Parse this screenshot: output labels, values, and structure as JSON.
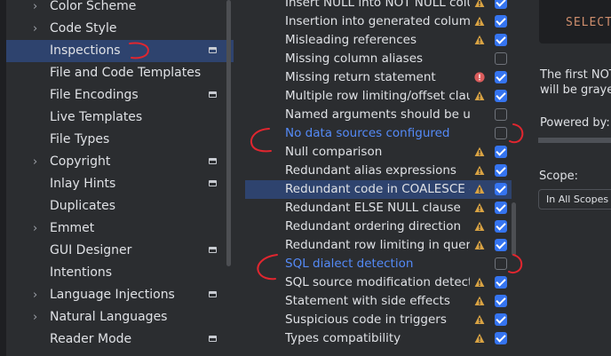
{
  "sidebar": {
    "items": [
      {
        "label": "Color Scheme",
        "chevron": true,
        "badge": false,
        "selected": false
      },
      {
        "label": "Code Style",
        "chevron": true,
        "badge": false,
        "selected": false
      },
      {
        "label": "Inspections",
        "chevron": false,
        "badge": true,
        "selected": true
      },
      {
        "label": "File and Code Templates",
        "chevron": false,
        "badge": false,
        "selected": false
      },
      {
        "label": "File Encodings",
        "chevron": false,
        "badge": true,
        "selected": false
      },
      {
        "label": "Live Templates",
        "chevron": false,
        "badge": false,
        "selected": false
      },
      {
        "label": "File Types",
        "chevron": false,
        "badge": false,
        "selected": false
      },
      {
        "label": "Copyright",
        "chevron": true,
        "badge": true,
        "selected": false
      },
      {
        "label": "Inlay Hints",
        "chevron": false,
        "badge": true,
        "selected": false
      },
      {
        "label": "Duplicates",
        "chevron": false,
        "badge": false,
        "selected": false
      },
      {
        "label": "Emmet",
        "chevron": true,
        "badge": false,
        "selected": false
      },
      {
        "label": "GUI Designer",
        "chevron": false,
        "badge": true,
        "selected": false
      },
      {
        "label": "Intentions",
        "chevron": false,
        "badge": false,
        "selected": false
      },
      {
        "label": "Language Injections",
        "chevron": true,
        "badge": true,
        "selected": false
      },
      {
        "label": "Natural Languages",
        "chevron": true,
        "badge": false,
        "selected": false
      },
      {
        "label": "Reader Mode",
        "chevron": false,
        "badge": true,
        "selected": false
      }
    ]
  },
  "inspections": {
    "rows": [
      {
        "label": "Insert NULL into NOT NULL column",
        "severity": "warning",
        "checked": true,
        "link": false,
        "selected": false
      },
      {
        "label": "Insertion into generated columns",
        "severity": "warning",
        "checked": true,
        "link": false,
        "selected": false
      },
      {
        "label": "Misleading references",
        "severity": "warning",
        "checked": true,
        "link": false,
        "selected": false
      },
      {
        "label": "Missing column aliases",
        "severity": "none",
        "checked": false,
        "link": false,
        "selected": false
      },
      {
        "label": "Missing return statement",
        "severity": "error",
        "checked": true,
        "link": false,
        "selected": false
      },
      {
        "label": "Multiple row limiting/offset clauses",
        "severity": "warning",
        "checked": true,
        "link": false,
        "selected": false
      },
      {
        "label": "Named arguments should be used",
        "severity": "none",
        "checked": false,
        "link": false,
        "selected": false
      },
      {
        "label": "No data sources configured",
        "severity": "none",
        "checked": false,
        "link": true,
        "selected": false
      },
      {
        "label": "Null comparison",
        "severity": "warning",
        "checked": true,
        "link": false,
        "selected": false
      },
      {
        "label": "Redundant alias expressions",
        "severity": "warning",
        "checked": true,
        "link": false,
        "selected": false
      },
      {
        "label": "Redundant code in COALESCE call",
        "severity": "warning",
        "checked": true,
        "link": false,
        "selected": true
      },
      {
        "label": "Redundant ELSE NULL clause",
        "severity": "warning",
        "checked": true,
        "link": false,
        "selected": false
      },
      {
        "label": "Redundant ordering direction",
        "severity": "warning",
        "checked": true,
        "link": false,
        "selected": false
      },
      {
        "label": "Redundant row limiting in queries",
        "severity": "warning",
        "checked": true,
        "link": false,
        "selected": false
      },
      {
        "label": "SQL dialect detection",
        "severity": "none",
        "checked": false,
        "link": true,
        "selected": false
      },
      {
        "label": "SQL source modification detection",
        "severity": "warning",
        "checked": true,
        "link": false,
        "selected": false
      },
      {
        "label": "Statement with side effects",
        "severity": "warning",
        "checked": true,
        "link": false,
        "selected": false
      },
      {
        "label": "Suspicious code in triggers",
        "severity": "warning",
        "checked": true,
        "link": false,
        "selected": false
      },
      {
        "label": "Types compatibility",
        "severity": "warning",
        "checked": true,
        "link": false,
        "selected": false
      }
    ]
  },
  "details": {
    "sql_preview": "SELECT",
    "description_line1": "The first NOT",
    "description_line2": "will be graye",
    "powered_by": "Powered by:",
    "scope_label": "Scope:",
    "scope_value": "In All Scopes"
  },
  "colors": {
    "accent": "#3574f0",
    "selection": "#2e436e",
    "link": "#548af7",
    "warning": "#d9a343",
    "error": "#db5c5c",
    "annotation": "#e0262f"
  }
}
